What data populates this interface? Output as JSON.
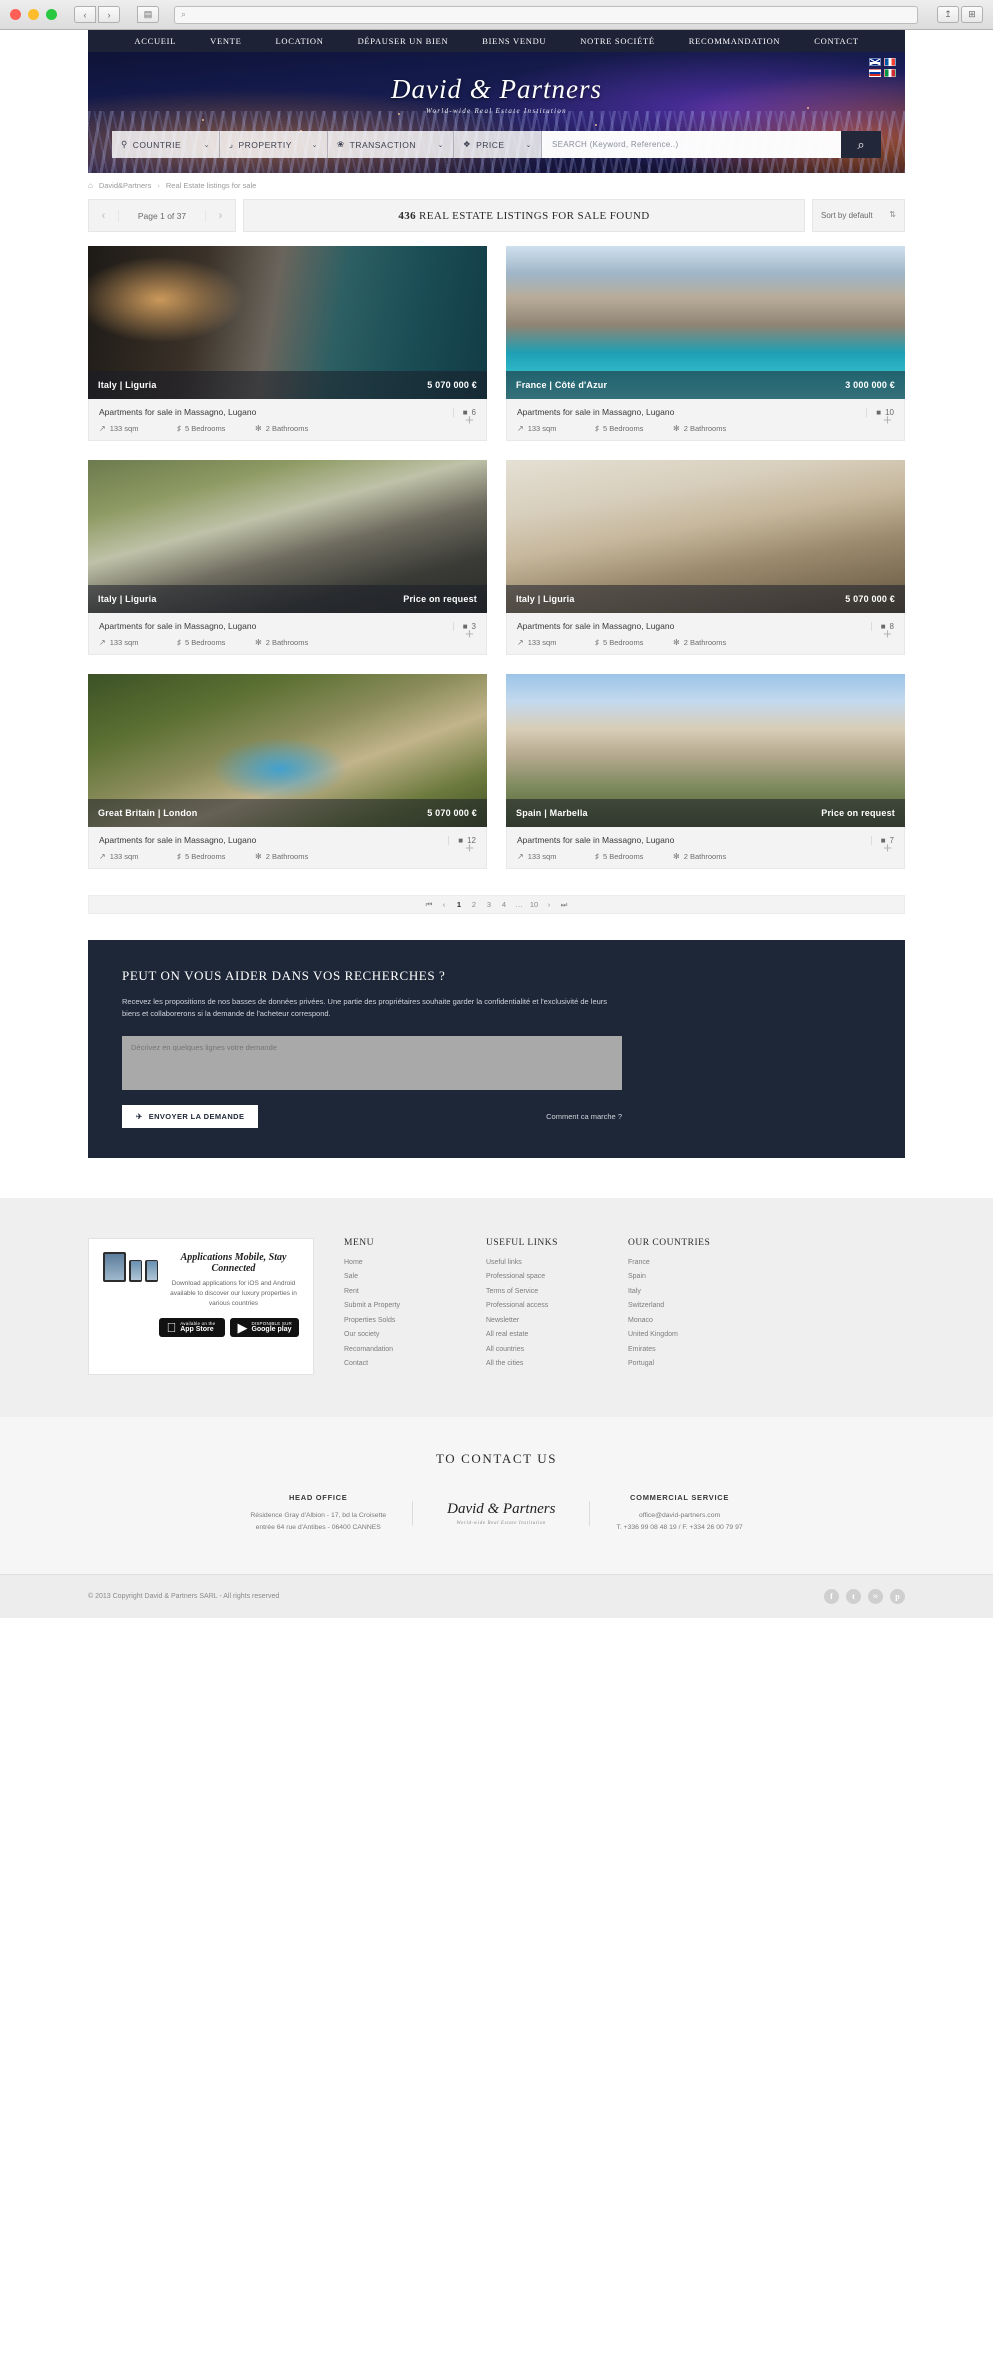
{
  "browser": {
    "omnibox_placeholder": "",
    "nav_back": "‹",
    "nav_forward": "›",
    "nav_reload": "⟳",
    "sidebar_icon": "▤",
    "share_icon": "↥",
    "tabs_icon": "⊞",
    "search_glyph": "⌕"
  },
  "topnav": {
    "items": [
      {
        "label": "ACCUEIL"
      },
      {
        "label": "VENTE"
      },
      {
        "label": "LOCATION"
      },
      {
        "label": "DÉPAUSER UN BIEN"
      },
      {
        "label": "BIENS VENDU"
      },
      {
        "label": "NOTRE SOCIÉTÉ"
      },
      {
        "label": "RECOMMANDATION"
      },
      {
        "label": "CONTACT"
      }
    ]
  },
  "brand": {
    "name": "David & Partners",
    "tagline": "World-wide Real Estate Institution"
  },
  "flags": [
    "uk",
    "fr",
    "ru",
    "it"
  ],
  "search": {
    "fields": [
      {
        "icon": "pin-icon",
        "glyph": "⚲",
        "label": "COUNTRIE",
        "chevron": "⌄"
      },
      {
        "icon": "bank-icon",
        "glyph": "🏛",
        "label": "PROPERTIY",
        "chevron": "⌄"
      },
      {
        "icon": "handshake-icon",
        "glyph": "⚘",
        "label": "TRANSACTION",
        "chevron": "⌄"
      },
      {
        "icon": "tag-icon",
        "glyph": "🏷",
        "label": "PRICE",
        "chevron": "⌄"
      }
    ],
    "placeholder": "SEARCH (Keyword, Reference..)",
    "button_icon": "⌕"
  },
  "breadcrumb": {
    "home_icon": "⌂",
    "items": [
      "David&Partners",
      "Real Estate listings for sale"
    ],
    "separator": "›"
  },
  "results": {
    "page_label": "Page 1 of 37",
    "prev": "‹",
    "next": "›",
    "count": "436",
    "count_text": "REAL ESTATE LISTINGS FOR SALE FOUND",
    "sort_label": "Sort by default",
    "sort_icon": "⇅"
  },
  "listings": [
    {
      "photo_class": "ph1",
      "location": "Italy | Liguria",
      "price": "5 070 000 €",
      "title": "Apartments for sale in Massagno, Lugano",
      "photos": "6",
      "photos_icon": "camera-icon",
      "area": "133 sqm",
      "bedrooms": "5 Bedrooms",
      "bathrooms": "2 Bathrooms"
    },
    {
      "photo_class": "ph2",
      "location": "France | Côté d'Azur",
      "price": "3 000 000 €",
      "title": "Apartments for sale in Massagno, Lugano",
      "photos": "10",
      "photos_icon": "camera-icon",
      "area": "133 sqm",
      "bedrooms": "5 Bedrooms",
      "bathrooms": "2 Bathrooms"
    },
    {
      "photo_class": "ph3",
      "location": "Italy | Liguria",
      "price": "Price on request",
      "title": "Apartments for sale in Massagno, Lugano",
      "photos": "3",
      "photos_icon": "camera-icon",
      "area": "133 sqm",
      "bedrooms": "5 Bedrooms",
      "bathrooms": "2 Bathrooms"
    },
    {
      "photo_class": "ph4",
      "location": "Italy | Liguria",
      "price": "5 070 000 €",
      "title": "Apartments for sale in Massagno, Lugano",
      "photos": "8",
      "photos_icon": "camera-icon",
      "area": "133 sqm",
      "bedrooms": "5 Bedrooms",
      "bathrooms": "2 Bathrooms"
    },
    {
      "photo_class": "ph5",
      "location": "Great Britain | London",
      "price": "5 070 000 €",
      "title": "Apartments for sale in Massagno, Lugano",
      "photos": "12",
      "photos_icon": "camera-icon",
      "area": "133 sqm",
      "bedrooms": "5 Bedrooms",
      "bathrooms": "2 Bathrooms"
    },
    {
      "photo_class": "ph6",
      "location": "Spain | Marbella",
      "price": "Price on request",
      "title": "Apartments for sale in Massagno, Lugano",
      "photos": "7",
      "photos_icon": "camera-icon",
      "area": "133 sqm",
      "bedrooms": "5 Bedrooms",
      "bathrooms": "2 Bathrooms"
    }
  ],
  "pagination": {
    "first": "⏮",
    "prev": "‹",
    "pages": [
      "1",
      "2",
      "3",
      "4",
      "…",
      "10"
    ],
    "current": "1",
    "next": "›",
    "last": "⏭"
  },
  "cta": {
    "heading": "PEUT ON VOUS AIDER DANS VOS RECHERCHES ?",
    "paragraph": "Recevez les propositions de nos basses de données privées. Une partie des propriétaires souhaite garder la confidentialité et l'exclusivité de leurs biens et collaborerons si la demande de l'acheteur correspond.",
    "textarea_placeholder": "Décrivez en quelques lignes votre demande",
    "button_label": "ENVOYER LA DEMANDE",
    "button_icon": "✈",
    "how_link": "Comment ca marche ?"
  },
  "app_promo": {
    "title": "Applications Mobile, Stay Connected",
    "description": "Download applications for iOS and Android available to discover our luxury properties in various countries",
    "badges": [
      {
        "icon": "apple-icon",
        "glyph": "",
        "small": "Available on the",
        "large": "App Store"
      },
      {
        "icon": "play-icon",
        "glyph": "▶",
        "small": "DISPONIBLE SUR",
        "large": "Google play"
      }
    ]
  },
  "footer_columns": [
    {
      "heading": "MENU",
      "links": [
        "Home",
        "Sale",
        "Rent",
        "Submit a Property",
        "Properties Solds",
        "Our society",
        "Recomandation",
        "Contact"
      ]
    },
    {
      "heading": "USEFUL LINKS",
      "links": [
        "Useful links",
        "Professional space",
        "Terms of Service",
        "Professional access",
        "Newsletter",
        "All real estate",
        "All countries",
        "All the cities"
      ]
    },
    {
      "heading": "OUR COUNTRIES",
      "links": [
        "France",
        "Spain",
        "Italy",
        "Switzerland",
        "Monaco",
        "United Kingdom",
        "Emirates",
        "Portugal"
      ]
    }
  ],
  "contact": {
    "heading": "TO CONTACT US",
    "head_office": {
      "title": "HEAD OFFICE",
      "line1": "Résidence Gray d'Albion - 17, bd la Croisette",
      "line2": "entrée 64 rue d'Antibes - 06400 CANNES"
    },
    "logo": "David & Partners",
    "logo_sub": "World-wide Real Estate Institution",
    "commercial": {
      "title": "COMMERCIAL SERVICE",
      "line1": "office@david-partners.com",
      "line2": "T. +336 99 08 48 19 / F. +334 26 00 79 97"
    }
  },
  "copyright": {
    "text": "© 2013 Copyright  David & Partners SARL  -  All rights reserved",
    "social": [
      {
        "name": "facebook-icon",
        "glyph": "f"
      },
      {
        "name": "twitter-icon",
        "glyph": "t"
      },
      {
        "name": "rss-icon",
        "glyph": "≈"
      },
      {
        "name": "pinterest-icon",
        "glyph": "p"
      }
    ]
  }
}
